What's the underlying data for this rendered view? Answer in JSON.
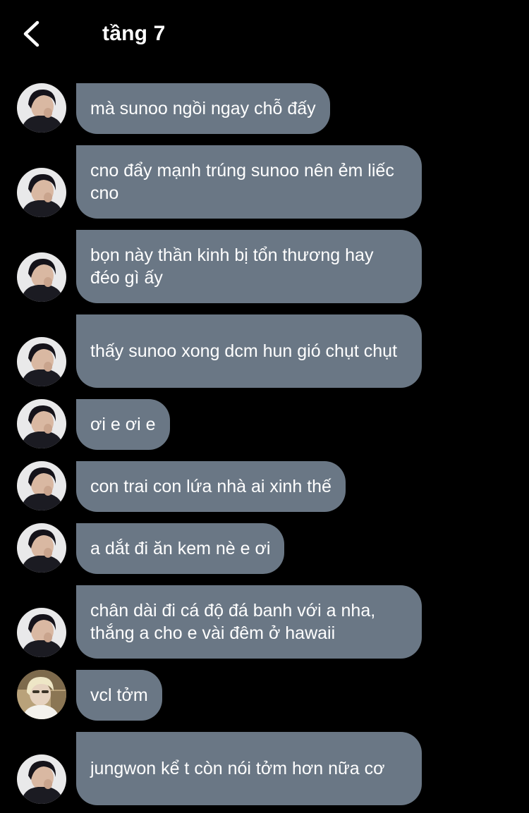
{
  "header": {
    "title": "tầng 7",
    "back_icon": "chevron-left-icon"
  },
  "colors": {
    "background": "#000000",
    "bubble": "#6a7785",
    "text": "#ffffff"
  },
  "messages": [
    {
      "sender_avatar": "avatar-dark-hair",
      "text": "mà sunoo ngồi ngay chỗ đấy"
    },
    {
      "sender_avatar": "avatar-dark-hair",
      "text": "cno đẩy mạnh trúng sunoo nên ẻm liếc cno"
    },
    {
      "sender_avatar": "avatar-dark-hair",
      "text": "bọn này thần kinh bị tổn thương hay đéo gì ấy"
    },
    {
      "sender_avatar": "avatar-dark-hair",
      "text": "thấy sunoo xong dcm hun gió chụt chụt"
    },
    {
      "sender_avatar": "avatar-dark-hair",
      "text": "ơi e ơi e"
    },
    {
      "sender_avatar": "avatar-dark-hair",
      "text": "con trai con lứa nhà ai xinh thế"
    },
    {
      "sender_avatar": "avatar-dark-hair",
      "text": "a dắt đi ăn kem nè e ơi"
    },
    {
      "sender_avatar": "avatar-dark-hair",
      "text": "chân dài đi cá độ đá banh với a nha, thắng a cho e vài đêm ở hawaii"
    },
    {
      "sender_avatar": "avatar-blonde-hair",
      "text": "vcl tởm"
    },
    {
      "sender_avatar": "avatar-dark-hair",
      "text": "jungwon kể t còn nói tởm hơn nữa cơ"
    }
  ]
}
